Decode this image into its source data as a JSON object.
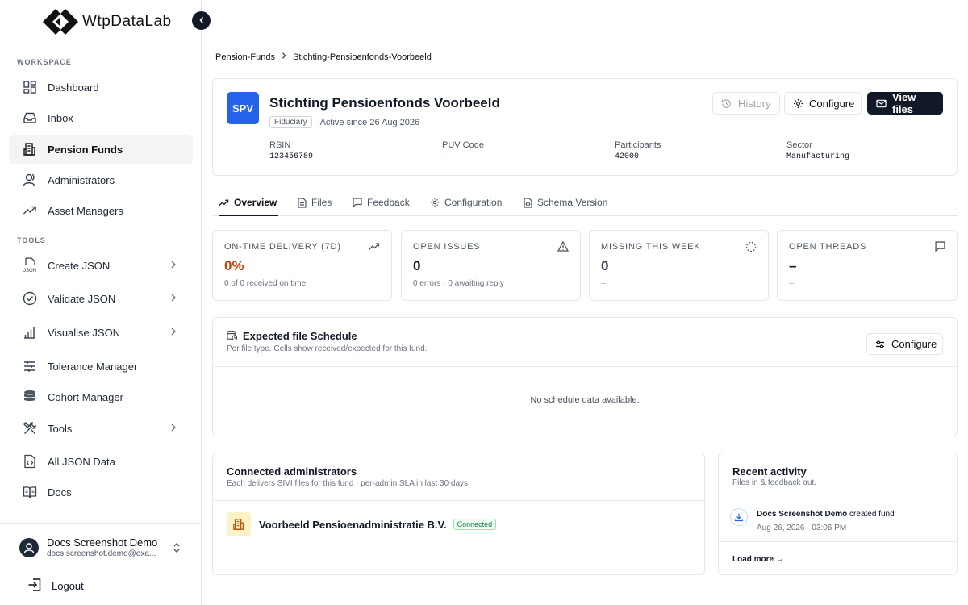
{
  "app": {
    "name": "WtpDataLab"
  },
  "sidebar": {
    "workspace_label": "WORKSPACE",
    "tools_label": "TOOLS",
    "workspace_items": [
      {
        "label": "Dashboard",
        "icon": "dashboard-icon"
      },
      {
        "label": "Inbox",
        "icon": "inbox-icon"
      },
      {
        "label": "Pension Funds",
        "icon": "building-icon",
        "active": true
      },
      {
        "label": "Administrators",
        "icon": "users-icon"
      },
      {
        "label": "Asset Managers",
        "icon": "trending-up-icon"
      }
    ],
    "tool_items": [
      {
        "label": "Create JSON",
        "icon": "json-file-icon",
        "has_chevron": true
      },
      {
        "label": "Validate JSON",
        "icon": "check-circle-icon",
        "has_chevron": true
      },
      {
        "label": "Visualise JSON",
        "icon": "bar-chart-icon",
        "has_chevron": true
      },
      {
        "label": "Tolerance Manager",
        "icon": "sliders-icon"
      },
      {
        "label": "Cohort Manager",
        "icon": "database-icon"
      },
      {
        "label": "Tools",
        "icon": "wrench-icon",
        "has_chevron": true
      },
      {
        "label": "All JSON Data",
        "icon": "code-file-icon"
      },
      {
        "label": "Docs",
        "icon": "book-icon"
      }
    ],
    "user": {
      "name": "Docs Screenshot Demo",
      "email": "docs.screenshot.demo@exa..."
    },
    "logout_label": "Logout"
  },
  "breadcrumb": {
    "parent": "Pension-Funds",
    "current": "Stichting-Pensioenfonds-Voorbeeld"
  },
  "fund": {
    "badge": "SPV",
    "name": "Stichting Pensioenfonds Voorbeeld",
    "role_tag": "Fiduciary",
    "active_since": "Active since 26 Aug 2026",
    "fields": [
      {
        "label": "RSIN",
        "value": "123456789"
      },
      {
        "label": "PUV Code",
        "value": "–"
      },
      {
        "label": "Participants",
        "value": "42000"
      },
      {
        "label": "Sector",
        "value": "Manufacturing"
      }
    ],
    "history_label": "History",
    "configure_label": "Configure",
    "view_files_label": "View files"
  },
  "tabs": [
    {
      "label": "Overview",
      "active": true
    },
    {
      "label": "Files"
    },
    {
      "label": "Feedback"
    },
    {
      "label": "Configuration"
    },
    {
      "label": "Schema Version"
    }
  ],
  "stats": [
    {
      "label": "ON-TIME DELIVERY (7D)",
      "value": "0%",
      "sub": "0 of 0 received on time",
      "color": "#c2410c"
    },
    {
      "label": "OPEN ISSUES",
      "value": "0",
      "sub": "0 errors · 0 awaiting reply",
      "color": "#111827"
    },
    {
      "label": "MISSING THIS WEEK",
      "value": "0",
      "sub": "–",
      "color": "#334155"
    },
    {
      "label": "OPEN THREADS",
      "value": "–",
      "sub": "–",
      "color": "#111827"
    }
  ],
  "schedule": {
    "title": "Expected file Schedule",
    "subtitle": "Per file type. Cells show received/expected for this fund.",
    "configure_label": "Configure",
    "empty": "No schedule data available."
  },
  "administrators": {
    "title": "Connected administrators",
    "subtitle": "Each delivers SIVI files for this fund · per-admin SLA in last 30 days.",
    "items": [
      {
        "name": "Voorbeeld Pensioenadministratie B.V.",
        "status": "Connected"
      }
    ]
  },
  "activity": {
    "title": "Recent activity",
    "subtitle": "Files in & feedback out.",
    "items": [
      {
        "actor": "Docs Screenshot Demo",
        "action": "created fund",
        "time": "Aug 26, 2026 · 03:06 PM"
      }
    ],
    "load_more": "Load more →"
  },
  "colors": {
    "primary": "#111827",
    "accent_blue": "#2563eb",
    "orange": "#c2410c",
    "green": "#15803d"
  }
}
